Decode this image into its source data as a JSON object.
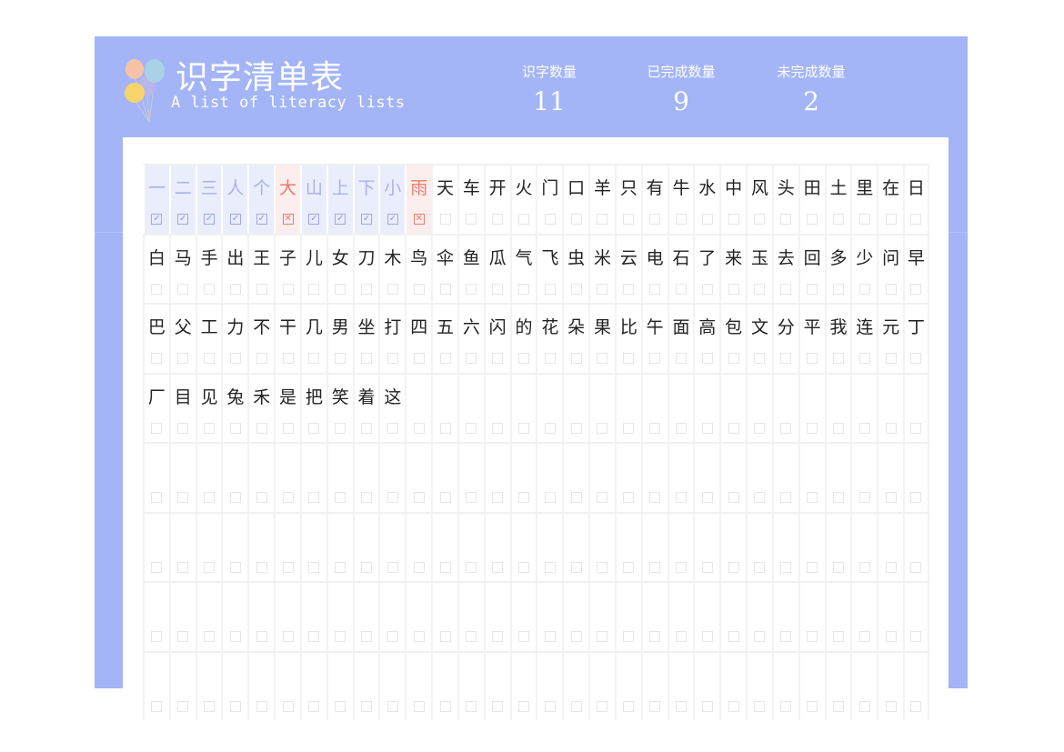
{
  "header": {
    "title": "识字清单表",
    "subtitle": "A list of literacy lists",
    "balloon_icon": "balloons-icon"
  },
  "stats": [
    {
      "label": "识字数量",
      "value": "11"
    },
    {
      "label": "已完成数量",
      "value": "9"
    },
    {
      "label": "未完成数量",
      "value": "2"
    }
  ],
  "colors": {
    "frame": "#a3b5f7",
    "done_bg": "#eaeefc",
    "done_text": "#a9b0ee",
    "fail_bg": "#fdeeee",
    "fail_text": "#ef7a6c"
  },
  "grid": {
    "columns": 30,
    "rows": 8,
    "status_glyphs": {
      "done": "✓",
      "fail": "✕",
      "empty": ""
    },
    "characters": [
      {
        "char": "一",
        "status": "done"
      },
      {
        "char": "二",
        "status": "done"
      },
      {
        "char": "三",
        "status": "done"
      },
      {
        "char": "人",
        "status": "done"
      },
      {
        "char": "个",
        "status": "done"
      },
      {
        "char": "大",
        "status": "fail"
      },
      {
        "char": "山",
        "status": "done"
      },
      {
        "char": "上",
        "status": "done"
      },
      {
        "char": "下",
        "status": "done"
      },
      {
        "char": "小",
        "status": "done"
      },
      {
        "char": "雨",
        "status": "fail"
      },
      {
        "char": "天",
        "status": "empty"
      },
      {
        "char": "车",
        "status": "empty"
      },
      {
        "char": "开",
        "status": "empty"
      },
      {
        "char": "火",
        "status": "empty"
      },
      {
        "char": "门",
        "status": "empty"
      },
      {
        "char": "口",
        "status": "empty"
      },
      {
        "char": "羊",
        "status": "empty"
      },
      {
        "char": "只",
        "status": "empty"
      },
      {
        "char": "有",
        "status": "empty"
      },
      {
        "char": "牛",
        "status": "empty"
      },
      {
        "char": "水",
        "status": "empty"
      },
      {
        "char": "中",
        "status": "empty"
      },
      {
        "char": "风",
        "status": "empty"
      },
      {
        "char": "头",
        "status": "empty"
      },
      {
        "char": "田",
        "status": "empty"
      },
      {
        "char": "土",
        "status": "empty"
      },
      {
        "char": "里",
        "status": "empty"
      },
      {
        "char": "在",
        "status": "empty"
      },
      {
        "char": "日",
        "status": "empty"
      },
      {
        "char": "白",
        "status": "empty"
      },
      {
        "char": "马",
        "status": "empty"
      },
      {
        "char": "手",
        "status": "empty"
      },
      {
        "char": "出",
        "status": "empty"
      },
      {
        "char": "王",
        "status": "empty"
      },
      {
        "char": "子",
        "status": "empty"
      },
      {
        "char": "儿",
        "status": "empty"
      },
      {
        "char": "女",
        "status": "empty"
      },
      {
        "char": "刀",
        "status": "empty"
      },
      {
        "char": "木",
        "status": "empty"
      },
      {
        "char": "鸟",
        "status": "empty"
      },
      {
        "char": "伞",
        "status": "empty"
      },
      {
        "char": "鱼",
        "status": "empty"
      },
      {
        "char": "瓜",
        "status": "empty"
      },
      {
        "char": "气",
        "status": "empty"
      },
      {
        "char": "飞",
        "status": "empty"
      },
      {
        "char": "虫",
        "status": "empty"
      },
      {
        "char": "米",
        "status": "empty"
      },
      {
        "char": "云",
        "status": "empty"
      },
      {
        "char": "电",
        "status": "empty"
      },
      {
        "char": "石",
        "status": "empty"
      },
      {
        "char": "了",
        "status": "empty"
      },
      {
        "char": "来",
        "status": "empty"
      },
      {
        "char": "玉",
        "status": "empty"
      },
      {
        "char": "去",
        "status": "empty"
      },
      {
        "char": "回",
        "status": "empty"
      },
      {
        "char": "多",
        "status": "empty"
      },
      {
        "char": "少",
        "status": "empty"
      },
      {
        "char": "问",
        "status": "empty"
      },
      {
        "char": "早",
        "status": "empty"
      },
      {
        "char": "巴",
        "status": "empty"
      },
      {
        "char": "父",
        "status": "empty"
      },
      {
        "char": "工",
        "status": "empty"
      },
      {
        "char": "力",
        "status": "empty"
      },
      {
        "char": "不",
        "status": "empty"
      },
      {
        "char": "干",
        "status": "empty"
      },
      {
        "char": "几",
        "status": "empty"
      },
      {
        "char": "男",
        "status": "empty"
      },
      {
        "char": "坐",
        "status": "empty"
      },
      {
        "char": "打",
        "status": "empty"
      },
      {
        "char": "四",
        "status": "empty"
      },
      {
        "char": "五",
        "status": "empty"
      },
      {
        "char": "六",
        "status": "empty"
      },
      {
        "char": "闪",
        "status": "empty"
      },
      {
        "char": "的",
        "status": "empty"
      },
      {
        "char": "花",
        "status": "empty"
      },
      {
        "char": "朵",
        "status": "empty"
      },
      {
        "char": "果",
        "status": "empty"
      },
      {
        "char": "比",
        "status": "empty"
      },
      {
        "char": "午",
        "status": "empty"
      },
      {
        "char": "面",
        "status": "empty"
      },
      {
        "char": "高",
        "status": "empty"
      },
      {
        "char": "包",
        "status": "empty"
      },
      {
        "char": "文",
        "status": "empty"
      },
      {
        "char": "分",
        "status": "empty"
      },
      {
        "char": "平",
        "status": "empty"
      },
      {
        "char": "我",
        "status": "empty"
      },
      {
        "char": "连",
        "status": "empty"
      },
      {
        "char": "元",
        "status": "empty"
      },
      {
        "char": "丁",
        "status": "empty"
      },
      {
        "char": "厂",
        "status": "empty"
      },
      {
        "char": "目",
        "status": "empty"
      },
      {
        "char": "见",
        "status": "empty"
      },
      {
        "char": "兔",
        "status": "empty"
      },
      {
        "char": "禾",
        "status": "empty"
      },
      {
        "char": "是",
        "status": "empty"
      },
      {
        "char": "把",
        "status": "empty"
      },
      {
        "char": "笑",
        "status": "empty"
      },
      {
        "char": "着",
        "status": "empty"
      },
      {
        "char": "这",
        "status": "empty"
      }
    ]
  }
}
